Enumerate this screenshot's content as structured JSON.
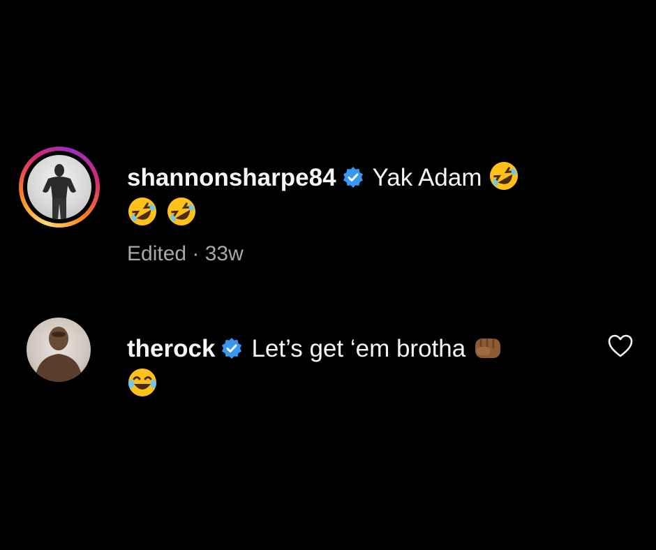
{
  "comments": [
    {
      "username": "shannonsharpe84",
      "verified": true,
      "text": "Yak Adam",
      "emojis_inline": [
        "rolling-on-floor-laughing"
      ],
      "emojis_line2": [
        "rolling-on-floor-laughing",
        "rolling-on-floor-laughing"
      ],
      "meta": "Edited · 33w",
      "has_story_ring": true
    },
    {
      "username": "therock",
      "verified": true,
      "text": "Let’s get ‘em brotha",
      "emojis_inline": [
        "oncoming-fist-medium-dark"
      ],
      "emojis_line2": [
        "face-with-tears-of-joy"
      ],
      "has_like_button": true
    }
  ],
  "icons": {
    "verified_color": "#3897f0",
    "heart_icon": "heart-outline-icon"
  }
}
